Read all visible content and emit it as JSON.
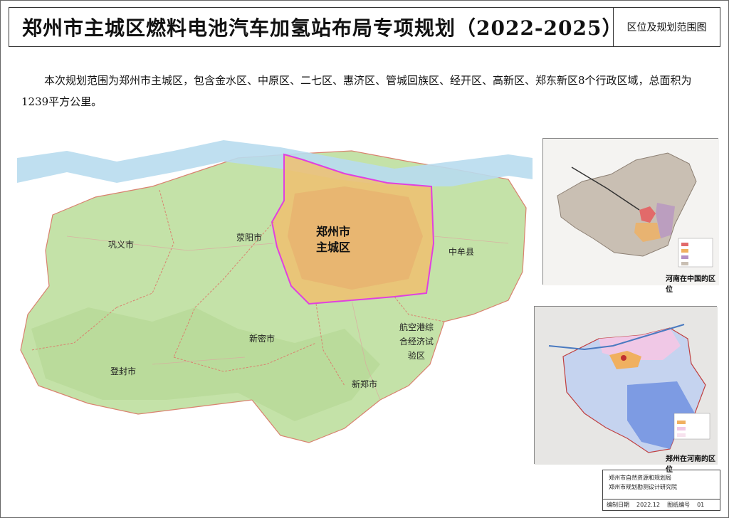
{
  "header": {
    "title": "郑州市主城区燃料电池汽车加氢站布局专项规划（2022-2025）",
    "section": "区位及规划范围图"
  },
  "description": "本次规划范围为郑州市主城区，包含金水区、中原区、二七区、惠济区、管城回族区、经开区、高新区、郑东新区8个行政区域，总面积为1239平方公里。",
  "map": {
    "core_area_line1": "郑州市",
    "core_area_line2": "主城区",
    "regions": {
      "gongyi": "巩义市",
      "xingyang": "荥阳市",
      "zhongmou": "中牟县",
      "xinmi": "新密市",
      "dengfeng": "登封市",
      "xinzheng": "新郑市",
      "airport_line1": "航空港综",
      "airport_line2": "合经济试",
      "airport_line3": "验区"
    },
    "colors": {
      "boundary": "#e040e0",
      "water": "#b8dcee",
      "green": "#c4e2a8",
      "urban": "#f0c070"
    }
  },
  "insets": {
    "china_caption": "河南在中国的区位",
    "henan_caption": "郑州在河南的区位"
  },
  "footer": {
    "org1": "郑州市自然资源和规划局",
    "org2": "郑州市规划勘测设计研究院",
    "date_label": "编制日期",
    "date_value": "2022.12",
    "drawing_no_label": "图纸编号",
    "drawing_no_value": "01"
  }
}
